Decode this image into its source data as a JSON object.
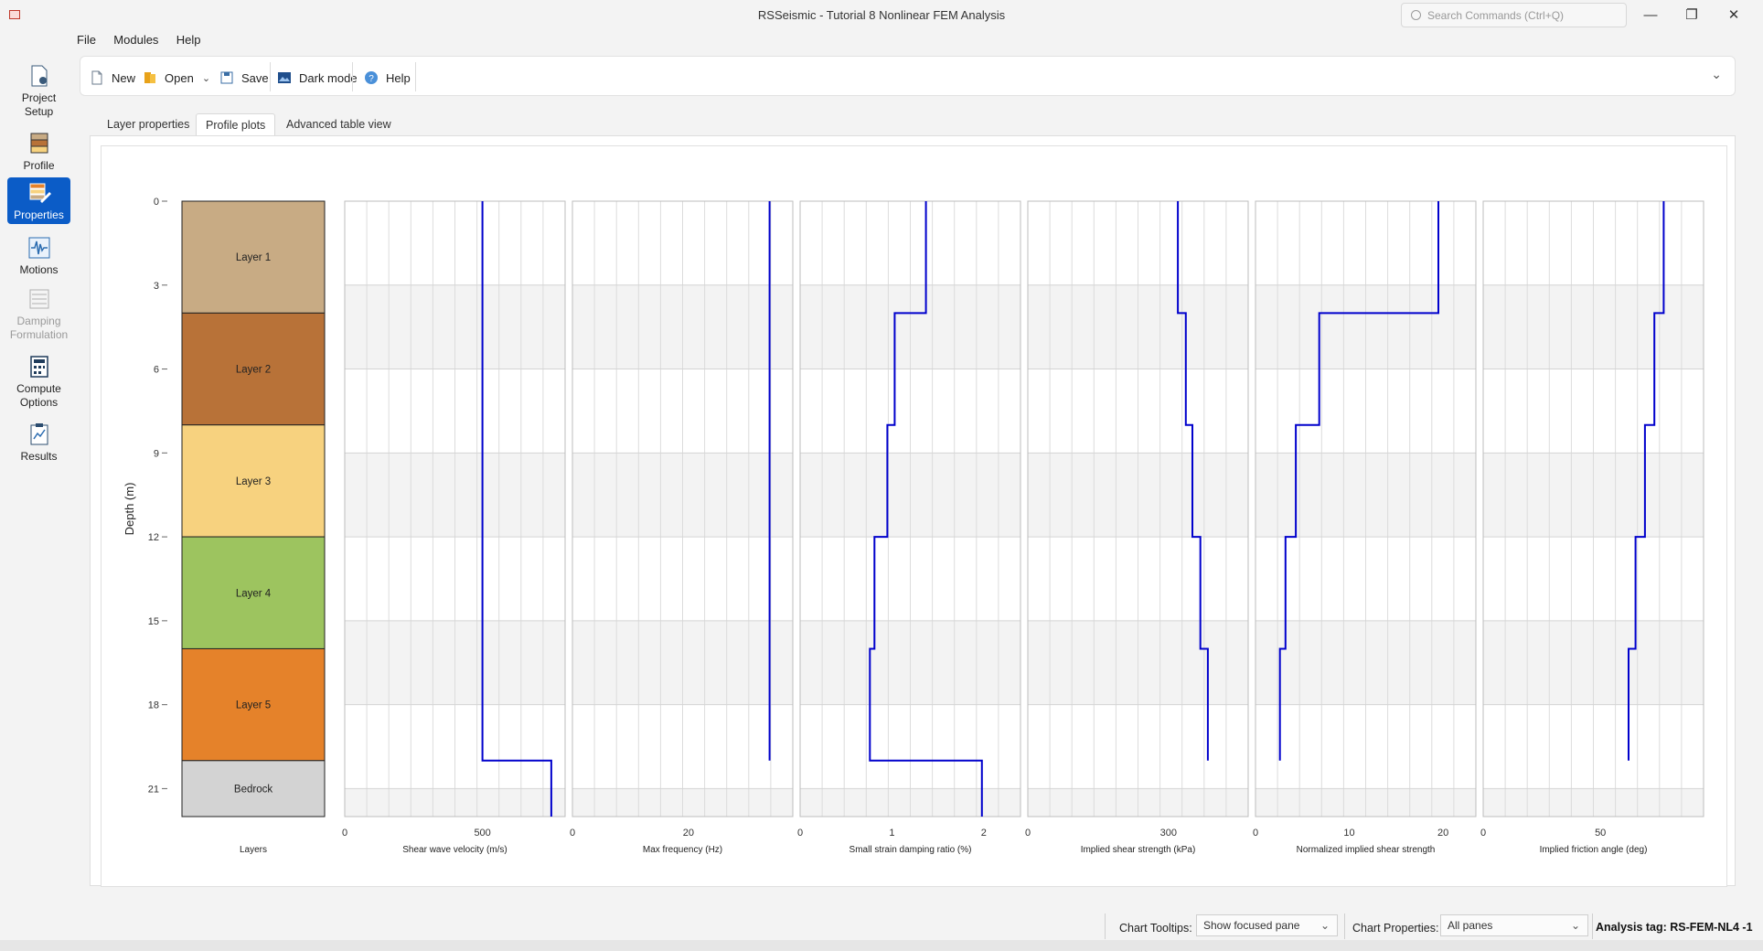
{
  "window": {
    "title": "RSSeismic - Tutorial 8 Nonlinear FEM Analysis",
    "search_placeholder": "Search Commands (Ctrl+Q)",
    "minimize": "—",
    "maximize": "❐",
    "close": "✕"
  },
  "menu": {
    "file": "File",
    "modules": "Modules",
    "help": "Help"
  },
  "toolbar": {
    "new": "New",
    "open": "Open",
    "save": "Save",
    "dark_mode": "Dark mode",
    "help": "Help"
  },
  "nav": [
    {
      "line1": "Project",
      "line2": "Setup"
    },
    {
      "line1": "Profile",
      "line2": ""
    },
    {
      "line1": "Properties",
      "line2": ""
    },
    {
      "line1": "Motions",
      "line2": ""
    },
    {
      "line1": "Damping",
      "line2": "Formulation"
    },
    {
      "line1": "Compute",
      "line2": "Options"
    },
    {
      "line1": "Results",
      "line2": ""
    }
  ],
  "tabs": {
    "layer_properties": "Layer properties",
    "profile_plots": "Profile plots",
    "advanced_table": "Advanced table view"
  },
  "status": {
    "chart_tooltips_label": "Chart Tooltips:",
    "chart_tooltips_value": "Show focused pane",
    "chart_properties_label": "Chart Properties:",
    "chart_properties_value": "All panes",
    "analysis_tag": "Analysis tag: RS-FEM-NL4 -1"
  },
  "colors": {
    "accent": "#0b5cc7",
    "line": "#0000cc"
  },
  "chart_data": {
    "type": "line",
    "ylabel": "Depth (m)",
    "yticks": [
      0,
      3,
      6,
      9,
      12,
      15,
      18,
      21
    ],
    "ylim": [
      0,
      22
    ],
    "grid": true,
    "layers_panel": {
      "xlabel": "Layers",
      "layers": [
        {
          "name": "Layer 1",
          "top": 0,
          "bottom": 4,
          "color": "#c8ab84"
        },
        {
          "name": "Layer 2",
          "top": 4,
          "bottom": 8,
          "color": "#b87238"
        },
        {
          "name": "Layer 3",
          "top": 8,
          "bottom": 12,
          "color": "#f7d27f"
        },
        {
          "name": "Layer 4",
          "top": 12,
          "bottom": 16,
          "color": "#9dc45f"
        },
        {
          "name": "Layer 5",
          "top": 16,
          "bottom": 20,
          "color": "#e5822a"
        },
        {
          "name": "Bedrock",
          "top": 20,
          "bottom": 22,
          "color": "#d3d3d3"
        }
      ]
    },
    "panels": [
      {
        "xlabel": "Shear wave velocity (m/s)",
        "xlim": [
          0,
          800
        ],
        "xticks": [
          0,
          500
        ],
        "profile": [
          [
            0,
            500
          ],
          [
            20,
            500
          ],
          [
            20,
            750
          ],
          [
            22,
            750
          ]
        ]
      },
      {
        "xlabel": "Max frequency (Hz)",
        "xlim": [
          0,
          38
        ],
        "xticks": [
          0,
          20
        ],
        "profile": [
          [
            0,
            34
          ],
          [
            20,
            34
          ]
        ]
      },
      {
        "xlabel": "Small strain damping ratio (%)",
        "xlim": [
          0,
          2.4
        ],
        "xticks": [
          0,
          1,
          2
        ],
        "profile": [
          [
            0,
            1.37
          ],
          [
            4,
            1.37
          ],
          [
            4,
            1.03
          ],
          [
            8,
            1.03
          ],
          [
            8,
            0.95
          ],
          [
            12,
            0.95
          ],
          [
            12,
            0.81
          ],
          [
            16,
            0.81
          ],
          [
            16,
            0.76
          ],
          [
            20,
            0.76
          ],
          [
            20,
            1.98
          ],
          [
            22,
            1.98
          ]
        ]
      },
      {
        "xlabel": "Implied shear strength (kPa)",
        "xlim": [
          0,
          470
        ],
        "xticks": [
          0,
          300
        ],
        "profile": [
          [
            0,
            320
          ],
          [
            4,
            320
          ],
          [
            4,
            337
          ],
          [
            8,
            337
          ],
          [
            8,
            351
          ],
          [
            12,
            351
          ],
          [
            12,
            368
          ],
          [
            16,
            368
          ],
          [
            16,
            384
          ],
          [
            20,
            384
          ]
        ]
      },
      {
        "xlabel": "Normalized implied shear strength",
        "xlim": [
          0,
          23.5
        ],
        "xticks": [
          0,
          10,
          20
        ],
        "profile": [
          [
            0,
            19.5
          ],
          [
            4,
            19.5
          ],
          [
            4,
            6.8
          ],
          [
            8,
            6.8
          ],
          [
            8,
            4.3
          ],
          [
            12,
            4.3
          ],
          [
            12,
            3.2
          ],
          [
            16,
            3.2
          ],
          [
            16,
            2.6
          ],
          [
            20,
            2.6
          ]
        ]
      },
      {
        "xlabel": "Implied friction angle (deg)",
        "xlim": [
          0,
          94
        ],
        "xticks": [
          0,
          50
        ],
        "profile": [
          [
            0,
            77
          ],
          [
            4,
            77
          ],
          [
            4,
            73
          ],
          [
            8,
            73
          ],
          [
            8,
            69
          ],
          [
            12,
            69
          ],
          [
            12,
            65
          ],
          [
            16,
            65
          ],
          [
            16,
            62
          ],
          [
            20,
            62
          ]
        ]
      }
    ]
  }
}
